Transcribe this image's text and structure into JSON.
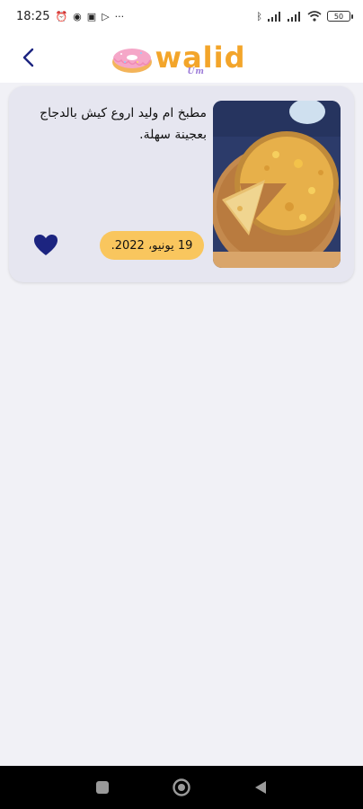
{
  "status_bar": {
    "time": "18:25",
    "battery": "50"
  },
  "header": {
    "logo_text": "walid",
    "logo_sub": "Um"
  },
  "post": {
    "title": "مطبخ ام وليد اروع كيش بالدجاج بعجينة سهلة.",
    "date": "19 يونيو، 2022.",
    "liked": true
  },
  "colors": {
    "accent_navy": "#1c2480",
    "badge_yellow": "#f9c65e",
    "logo_orange": "#f3a52a",
    "donut_pink": "#f5a7c8"
  },
  "icons": {
    "back": "chevron-left-icon",
    "favorite": "heart-icon",
    "nav_recent": "square-icon",
    "nav_home": "circle-icon",
    "nav_back": "triangle-back-icon"
  }
}
